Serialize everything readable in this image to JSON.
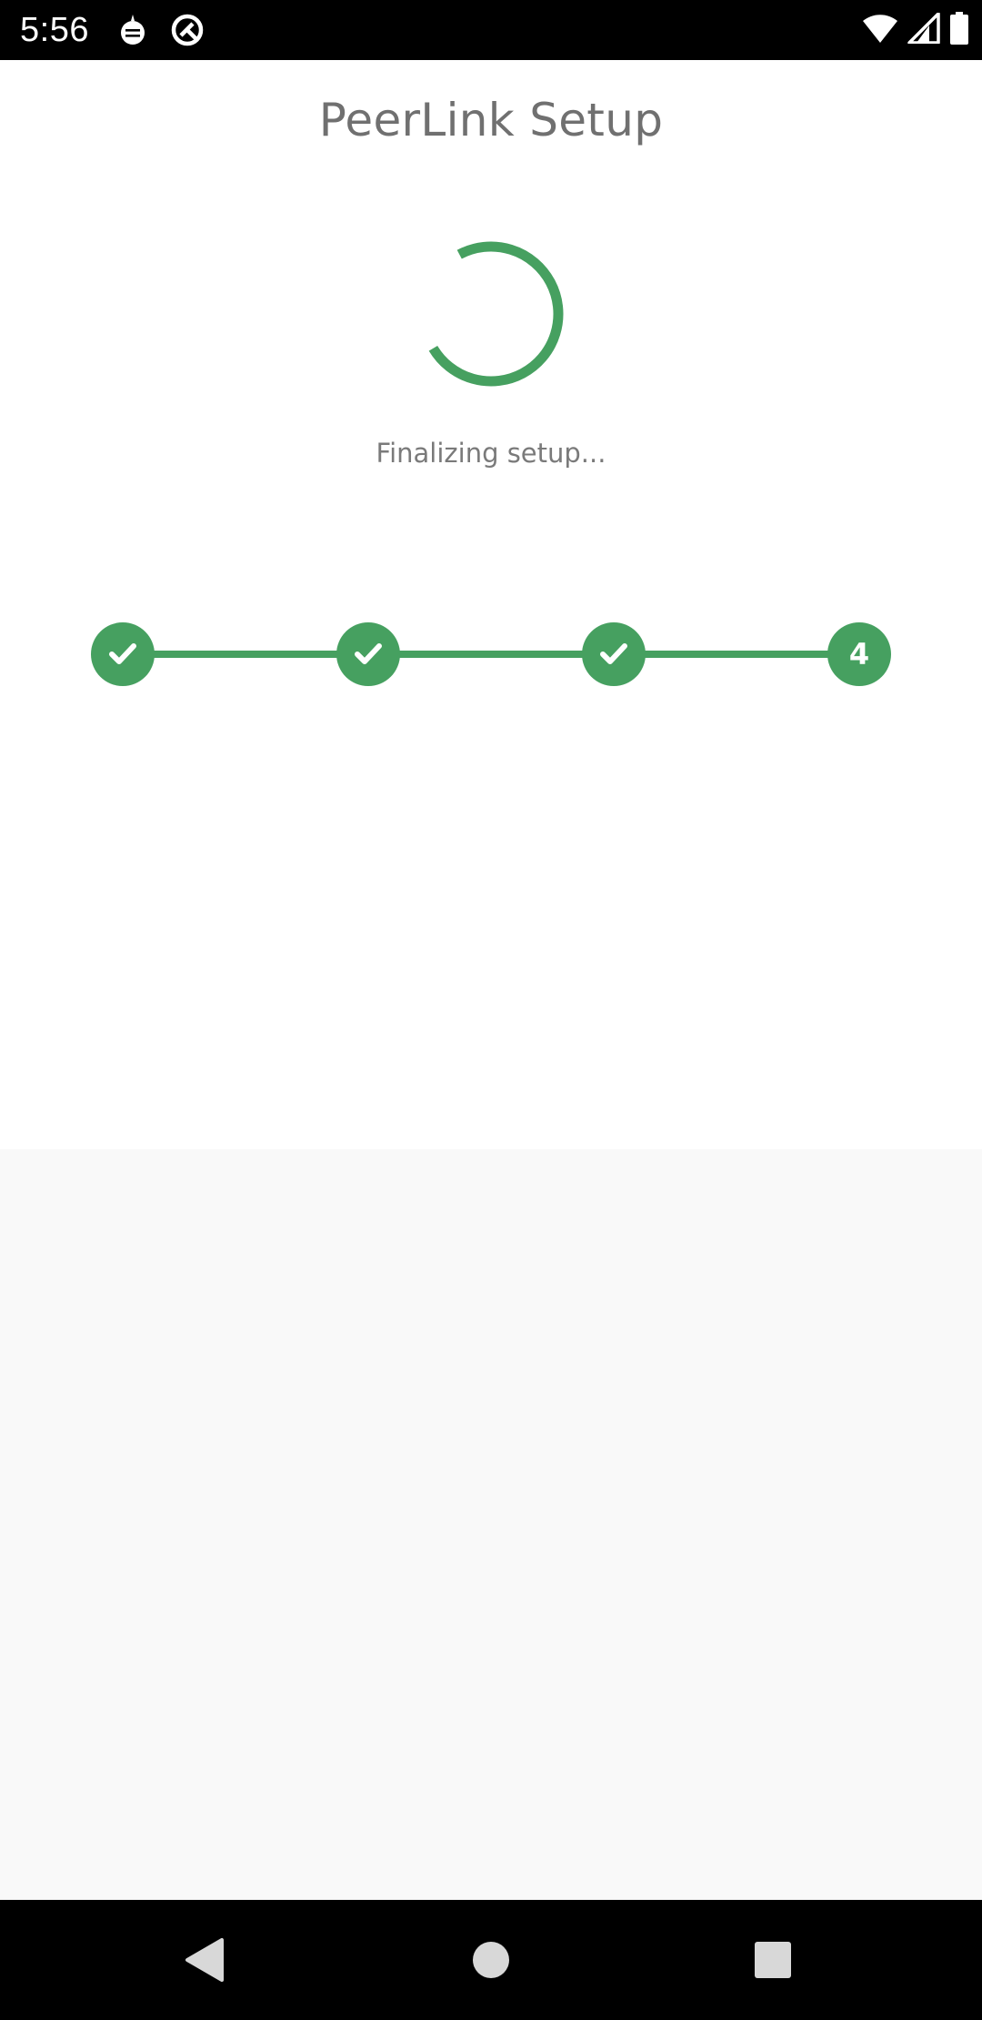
{
  "status_bar": {
    "time": "5:56",
    "icons": [
      "sim-notification-icon",
      "data-sync-icon",
      "wifi-icon",
      "cell-signal-icon",
      "battery-icon"
    ]
  },
  "header": {
    "title": "PeerLink Setup"
  },
  "progress": {
    "status_text": "Finalizing setup..."
  },
  "stepper": {
    "steps": [
      {
        "state": "complete",
        "icon": "check-icon"
      },
      {
        "state": "complete",
        "icon": "check-icon"
      },
      {
        "state": "complete",
        "icon": "check-icon"
      },
      {
        "state": "current",
        "label": "4"
      }
    ]
  },
  "nav_bar": {
    "buttons": [
      "back-icon",
      "home-icon",
      "recents-icon"
    ]
  },
  "colors": {
    "accent": "#46a060",
    "title_text": "#707070",
    "body_text": "#7a7a7a",
    "lower_background": "#f9f9f9"
  }
}
